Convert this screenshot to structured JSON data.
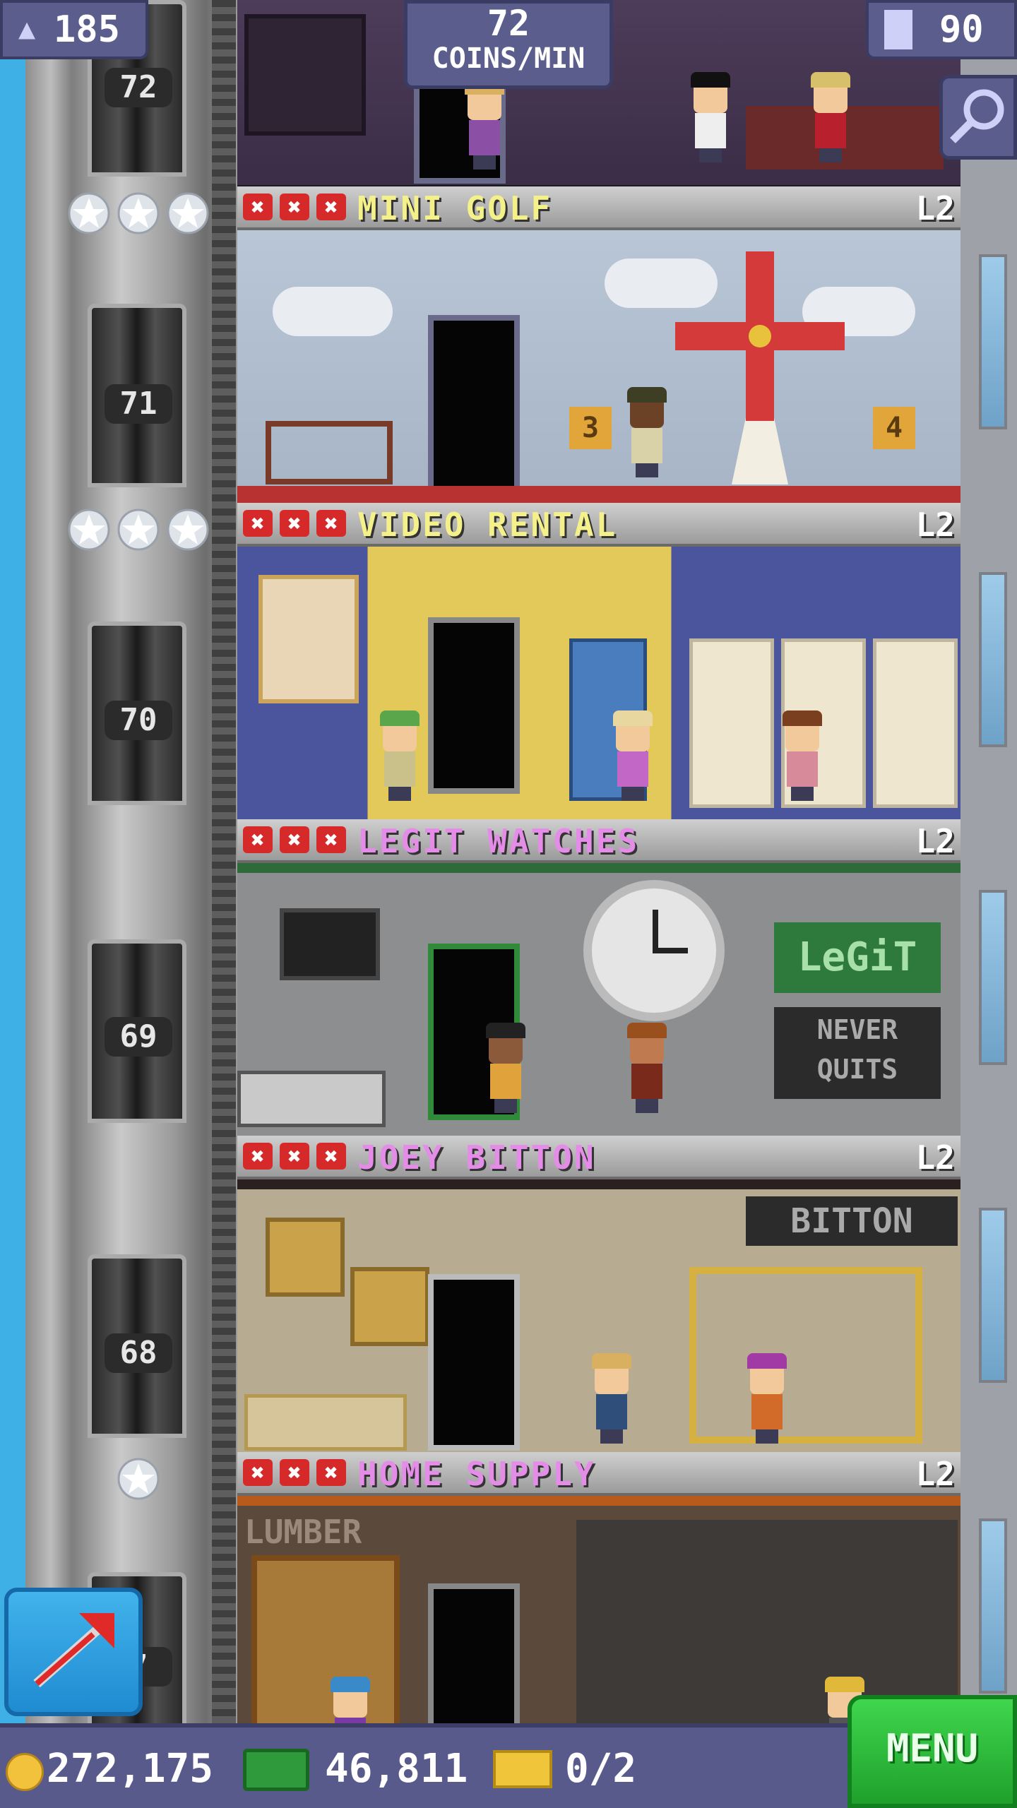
{
  "hud": {
    "population": "185",
    "coins_per_min_value": "72",
    "coins_per_min_unit": "COINS/MIN",
    "floors": "90"
  },
  "elevator": {
    "floor_numbers": [
      "72",
      "71",
      "70",
      "69",
      "68",
      "7"
    ]
  },
  "floors": [
    {
      "name": "MINI GOLF",
      "level": "L2",
      "stars": 3,
      "name_color": "#f4f08a",
      "sign_left": "3",
      "sign_right": "4"
    },
    {
      "name": "VIDEO RENTAL",
      "level": "L2",
      "stars": 3,
      "name_color": "#f4f08a"
    },
    {
      "name": "LEGIT WATCHES",
      "level": "L2",
      "stars": 0,
      "name_color": "#e48ce8",
      "logo": "LeGiT",
      "slogan_1": "NEVER",
      "slogan_2": "QUITS"
    },
    {
      "name": "JOEY BITTON",
      "level": "L2",
      "stars": 0,
      "name_color": "#e48ce8",
      "sign": "BITTON"
    },
    {
      "name": "HOME SUPPLY",
      "level": "L2",
      "stars": 1,
      "name_color": "#e48ce8",
      "sign": "LUMBER"
    }
  ],
  "stock_marks": [
    "✖",
    "✖",
    "✖"
  ],
  "bottom_bar": {
    "coins": "272,175",
    "bux": "46,811",
    "tickets": "0/2",
    "menu_label": "MENU"
  },
  "colors": {
    "hud_bg": "#5b5d8c",
    "menu_green": "#2cbf3b",
    "stock_red": "#d62a2a"
  },
  "icons": [
    "person-icon",
    "building-icon",
    "search-icon",
    "coin-icon",
    "bux-icon",
    "ticket-icon",
    "build-arrow-icon",
    "star-icon"
  ]
}
